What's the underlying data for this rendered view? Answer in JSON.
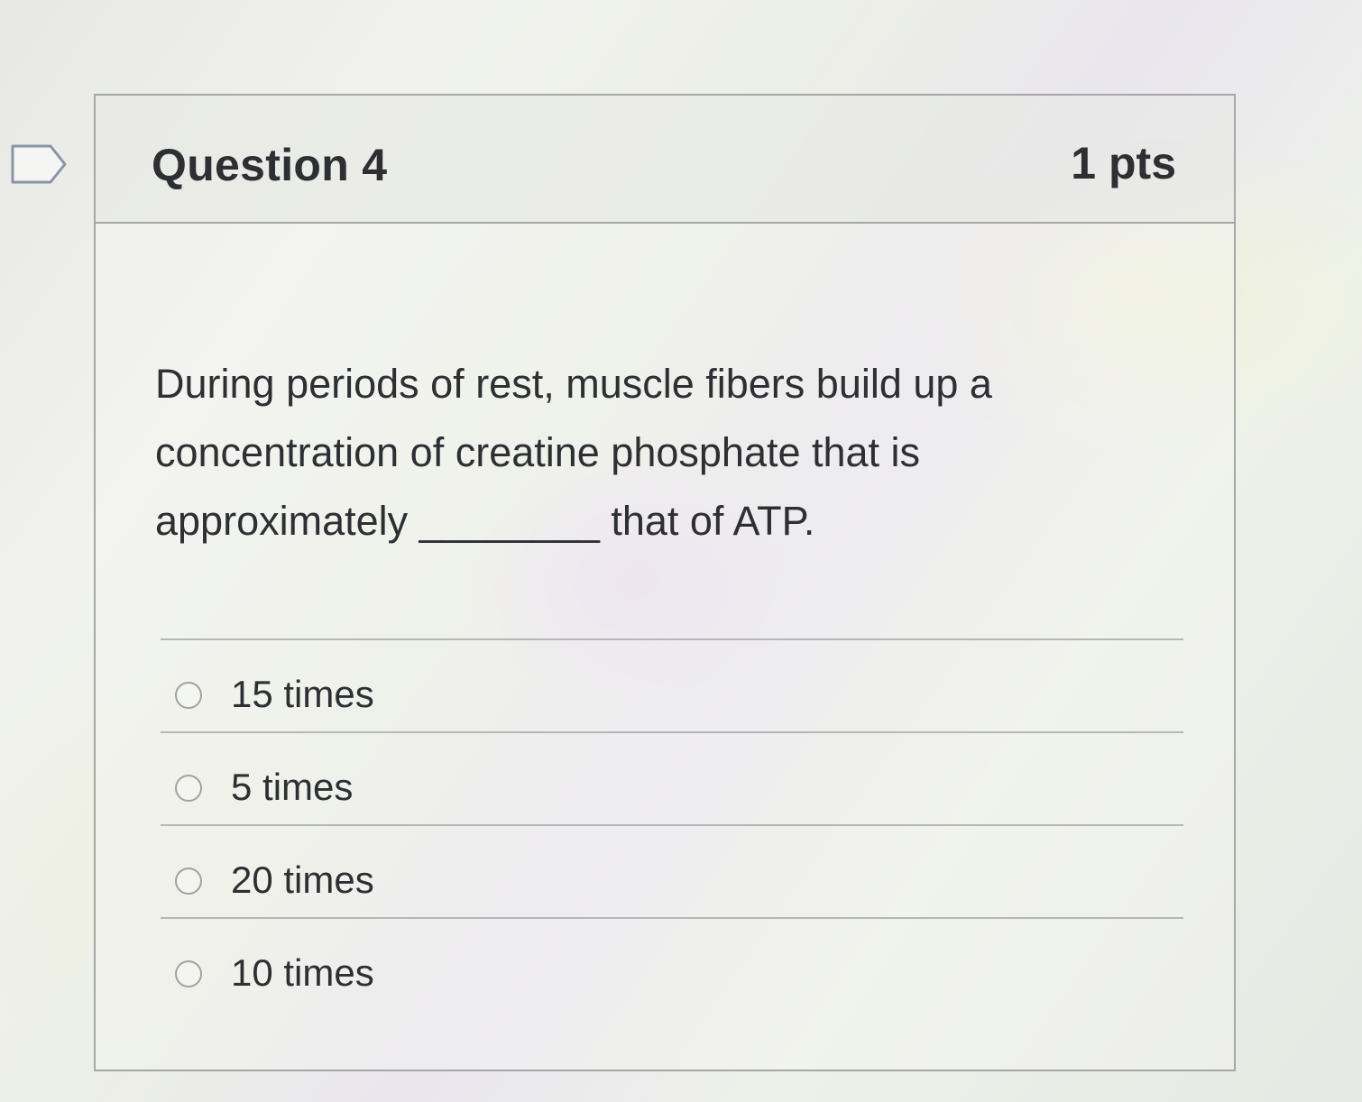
{
  "question": {
    "title": "Question 4",
    "points": "1 pts",
    "flag_icon": "flag-outline",
    "text": "During periods of rest, muscle fibers build up a concentration of creatine phosphate that is approximately ________ that of ATP.",
    "answers": [
      {
        "label": "15 times",
        "selected": false
      },
      {
        "label": "5 times",
        "selected": false
      },
      {
        "label": "20 times",
        "selected": false
      },
      {
        "label": "10 times",
        "selected": false
      }
    ]
  },
  "colors": {
    "text": "#2d2f33",
    "border": "#a6a8a6"
  }
}
